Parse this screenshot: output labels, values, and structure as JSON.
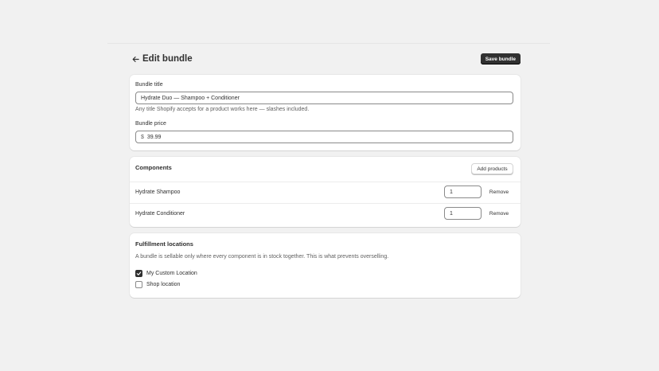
{
  "header": {
    "title": "Edit bundle",
    "save_label": "Save bundle"
  },
  "bundle": {
    "title_label": "Bundle title",
    "title_value": "Hydrate Duo — Shampoo + Conditioner",
    "title_help": "Any title Shopify accepts for a product works here — slashes included.",
    "price_label": "Bundle price",
    "price_prefix": "$",
    "price_value": "39.99"
  },
  "components": {
    "heading": "Components",
    "add_label": "Add products",
    "items": [
      {
        "name": "Hydrate Shampoo",
        "qty": "1",
        "remove_label": "Remove"
      },
      {
        "name": "Hydrate Conditioner",
        "qty": "1",
        "remove_label": "Remove"
      }
    ]
  },
  "fulfillment": {
    "heading": "Fulfillment locations",
    "description": "A bundle is sellable only where every component is in stock together. This is what prevents overselling.",
    "locations": [
      {
        "label": "My Custom Location",
        "checked": true
      },
      {
        "label": "Shop location",
        "checked": false
      }
    ]
  }
}
